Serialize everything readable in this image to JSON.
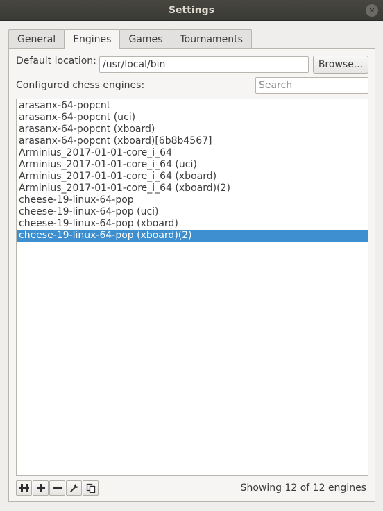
{
  "window": {
    "title": "Settings"
  },
  "tabs": [
    {
      "label": "General",
      "active": false
    },
    {
      "label": "Engines",
      "active": true
    },
    {
      "label": "Games",
      "active": false
    },
    {
      "label": "Tournaments",
      "active": false
    }
  ],
  "engines_tab": {
    "default_location_label": "Default location:",
    "default_location_value": "/usr/local/bin",
    "browse_label": "Browse...",
    "configured_label": "Configured chess engines:",
    "search_placeholder": "Search",
    "engines": [
      "arasanx-64-popcnt",
      "arasanx-64-popcnt (uci)",
      "arasanx-64-popcnt (xboard)",
      "arasanx-64-popcnt (xboard)[6b8b4567]",
      "Arminius_2017-01-01-core_i_64",
      "Arminius_2017-01-01-core_i_64 (uci)",
      "Arminius_2017-01-01-core_i_64 (xboard)",
      "Arminius_2017-01-01-core_i_64 (xboard)(2)",
      "cheese-19-linux-64-pop",
      "cheese-19-linux-64-pop (uci)",
      "cheese-19-linux-64-pop (xboard)",
      "cheese-19-linux-64-pop (xboard)(2)"
    ],
    "selected_index": 11,
    "status": "Showing 12 of 12 engines",
    "toolbar_icons": [
      "detect-engines-icon",
      "add-icon",
      "remove-icon",
      "configure-icon",
      "clone-icon"
    ]
  },
  "colors": {
    "selection": "#3e8fcf",
    "titlebar": "#3a3a35"
  }
}
